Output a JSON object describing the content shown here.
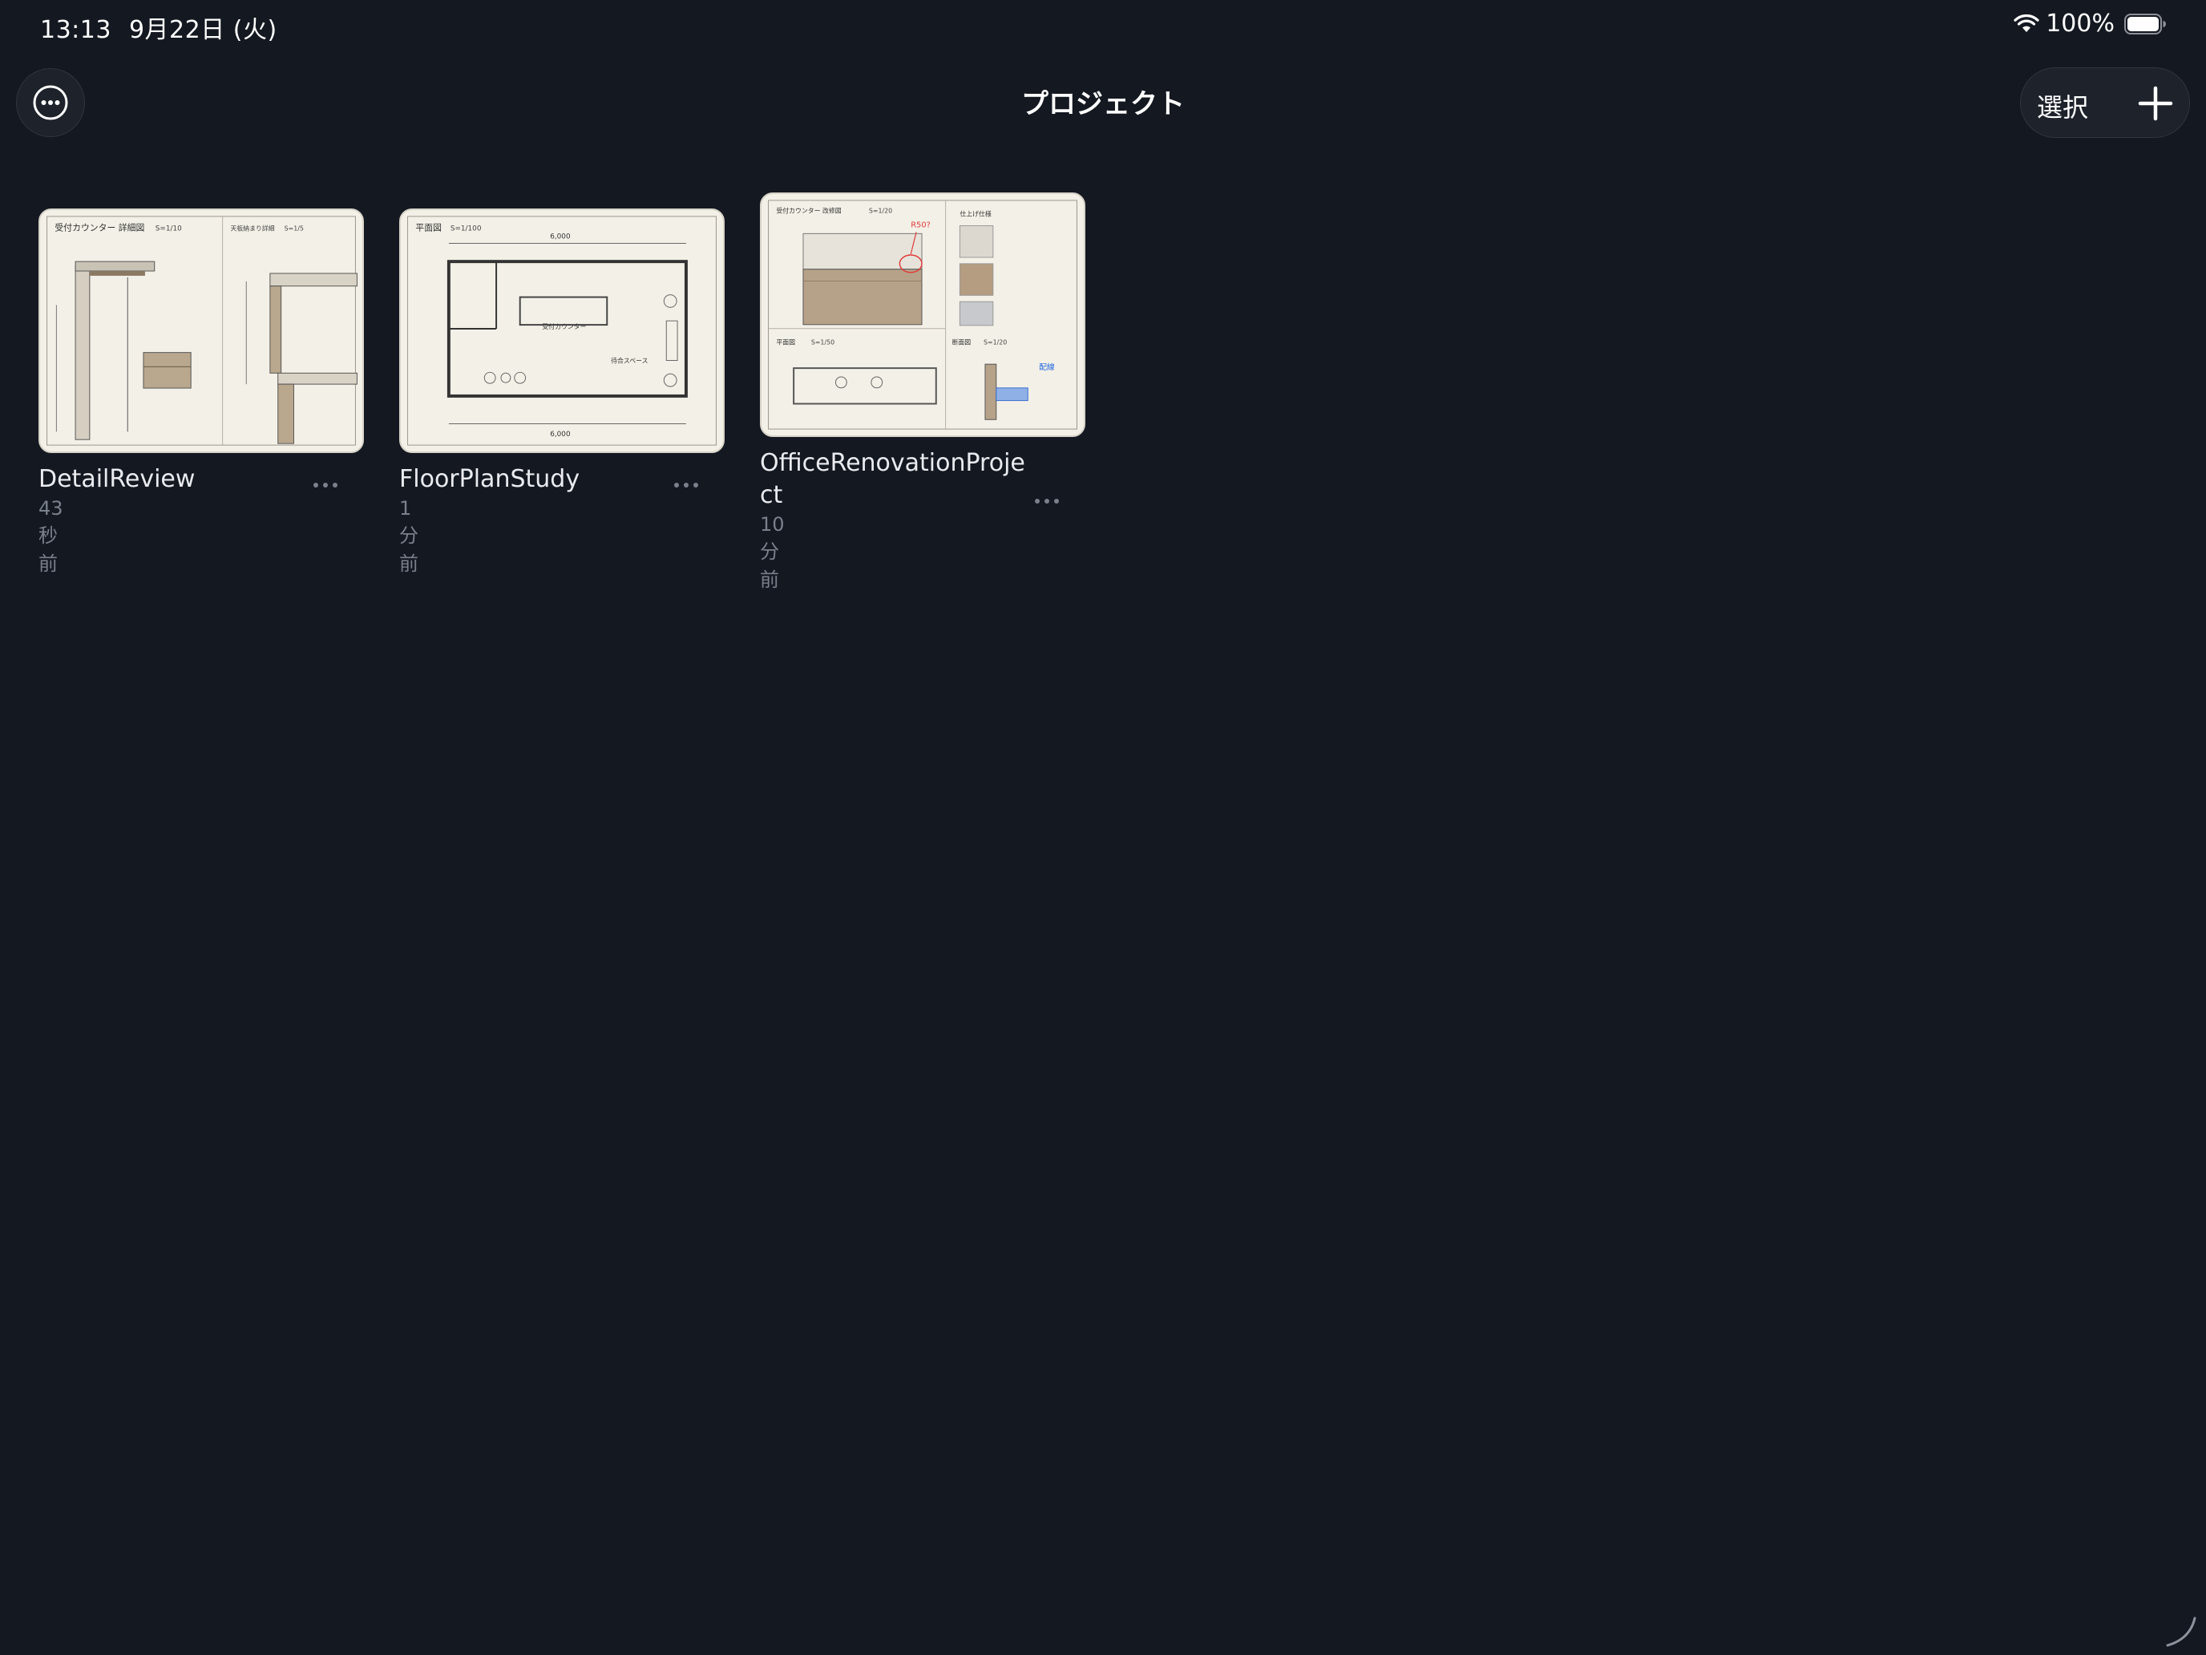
{
  "status_bar": {
    "time": "13:13",
    "date": "9月22日 (火)",
    "battery_percent": "100%",
    "battery_level": 1.0
  },
  "header": {
    "title": "プロジェクト",
    "select_label": "選択",
    "more_icon": "ellipsis-circle-icon",
    "add_icon": "plus-icon"
  },
  "projects": [
    {
      "name": "DetailReview",
      "time": "43 秒前",
      "thumb_title": "受付カウンター 詳細図",
      "thumb_scale": "S=1/10",
      "thumb_side_title": "天板納まり詳細",
      "thumb_side_scale": "S=1/5"
    },
    {
      "name": "FloorPlanStudy",
      "time": "1 分前",
      "thumb_title": "平面図",
      "thumb_scale": "S=1/100",
      "thumb_dim_top": "6,000",
      "thumb_dim_bottom": "6,000",
      "thumb_room": "受付カウンター",
      "thumb_room2": "待合スペース"
    },
    {
      "name": "OfficeRenovationProje\nct",
      "time": "10 分前",
      "thumb_title": "受付カウンター 改修図",
      "thumb_scale": "S=1/20",
      "thumb_side_title": "仕上げ仕様",
      "thumb_plan_title": "平面図",
      "thumb_plan_scale": "S=1/50",
      "thumb_section_title": "断面図",
      "thumb_section_scale": "S=1/20",
      "thumb_note": "R50?",
      "thumb_note2": "配線"
    }
  ],
  "colors": {
    "background": "#141821",
    "paper": "#f3f0e7",
    "secondary_text": "#7a808c"
  }
}
